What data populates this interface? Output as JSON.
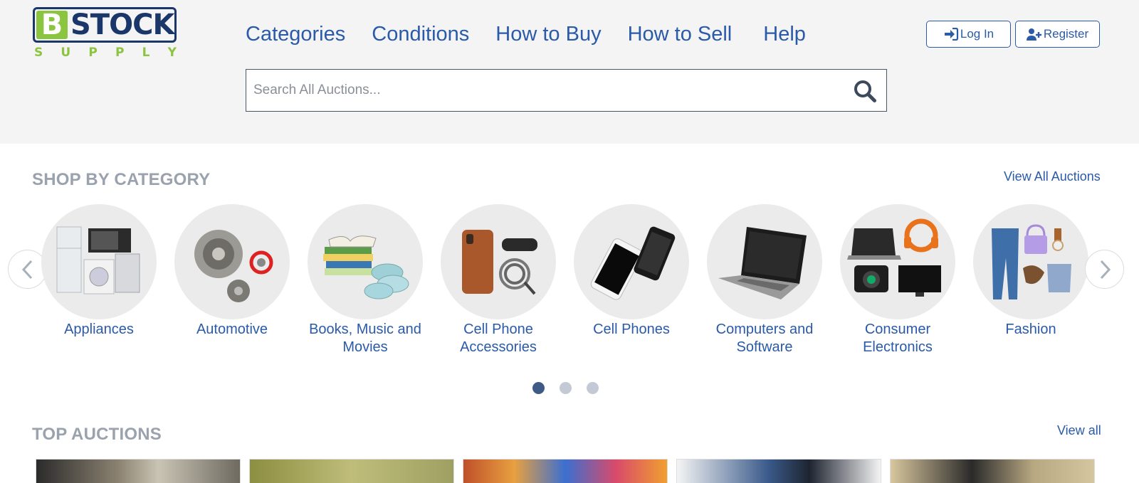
{
  "logo": {
    "letter": "B",
    "word": "STOCK",
    "sub": [
      "S",
      "U",
      "P",
      "P",
      "L",
      "Y"
    ]
  },
  "nav": {
    "items": [
      "Categories",
      "Conditions",
      "How to Buy",
      "How to Sell",
      "Help"
    ]
  },
  "auth": {
    "login": "Log In",
    "register": "Register"
  },
  "search": {
    "placeholder": "Search All Auctions..."
  },
  "shop_by_category": {
    "title": "SHOP BY CATEGORY",
    "link": "View All Auctions",
    "categories": [
      {
        "label": "Appliances",
        "icon": "appliances-icon"
      },
      {
        "label": "Automotive",
        "icon": "automotive-icon"
      },
      {
        "label": "Books, Music and Movies",
        "icon": "books-music-icon"
      },
      {
        "label": "Cell Phone Accessories",
        "icon": "phone-accessories-icon"
      },
      {
        "label": "Cell Phones",
        "icon": "cell-phones-icon"
      },
      {
        "label": "Computers and Software",
        "icon": "laptop-icon"
      },
      {
        "label": "Consumer Electronics",
        "icon": "electronics-icon"
      },
      {
        "label": "Fashion",
        "icon": "fashion-icon"
      }
    ],
    "pager": {
      "pages": 3,
      "active": 1
    }
  },
  "top_auctions": {
    "title": "TOP AUCTIONS",
    "link": "View all"
  },
  "colors": {
    "link": "#2a5aa8",
    "brand_navy": "#1b3769",
    "brand_green": "#8bc53f",
    "section_title": "#9aa3ad",
    "header_bg": "#f4f4f4"
  }
}
